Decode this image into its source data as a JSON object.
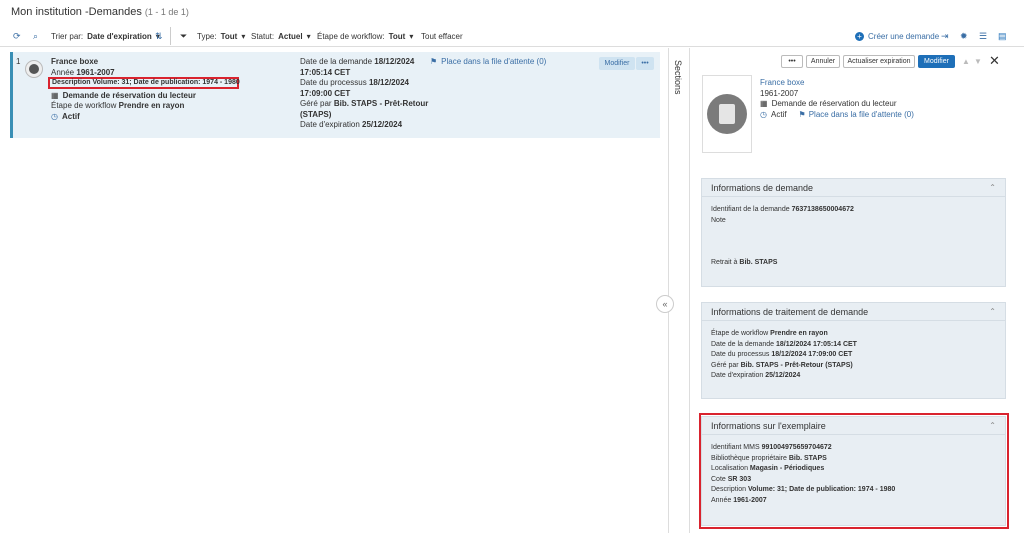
{
  "header": {
    "title": "Mon institution -Demandes",
    "count": "(1 - 1 de 1)"
  },
  "toolbar": {
    "sort_label": "Trier par:",
    "sort_value": "Date d'expiration",
    "type_label": "Type:",
    "type_value": "Tout",
    "status_label": "Statut:",
    "status_value": "Actuel",
    "workflow_label": "Étape de workflow:",
    "workflow_value": "Tout",
    "clear_all": "Tout effacer",
    "create_request": "Créer une demande"
  },
  "result": {
    "index": "1",
    "title": "France boxe",
    "year_label": "Année",
    "year": "1961-2007",
    "description": "Description Volume: 31; Date de publication: 1974 - 1980",
    "request_type": "Demande de réservation du lecteur",
    "workflow_label": "Étape de workflow",
    "workflow_value": "Prendre en rayon",
    "status": "Actif",
    "request_date_label": "Date de la demande",
    "request_date": "18/12/2024",
    "request_time": "17:05:14 CET",
    "process_date_label": "Date du processus",
    "process_date": "18/12/2024",
    "process_time": "17:09:00 CET",
    "managed_label": "Géré par",
    "managed_by": "Bib. STAPS - Prêt-Retour",
    "managed_by_2": "(STAPS)",
    "expiry_label": "Date d'expiration",
    "expiry_date": "25/12/2024",
    "queue_link": "Place dans la file d'attente (0)",
    "edit_button": "Modifier",
    "more_button": "•••"
  },
  "sections_label": "Sections",
  "detail": {
    "more_button": "•••",
    "cancel_button": "Annuler",
    "update_expiry_button": "Actualiser expiration",
    "edit_button": "Modifier",
    "title": "France boxe",
    "year": "1961-2007",
    "request_type": "Demande de réservation du lecteur",
    "status": "Actif",
    "queue_link": "Place dans la file d'attente (0)"
  },
  "panels": {
    "demand": {
      "title": "Informations de demande",
      "id_label": "Identifiant de la demande",
      "id": "7637138650004672",
      "note_label": "Note",
      "pickup_label": "Retrait à",
      "pickup": "Bib. STAPS"
    },
    "processing": {
      "title": "Informations de traitement de demande",
      "workflow_label": "Étape de workflow",
      "workflow": "Prendre en rayon",
      "request_date_label": "Date de la demande",
      "request_date": "18/12/2024 17:05:14 CET",
      "process_date_label": "Date du processus",
      "process_date": "18/12/2024 17:09:00 CET",
      "managed_label": "Géré par",
      "managed_by": "Bib. STAPS - Prêt-Retour (STAPS)",
      "expiry_label": "Date d'expiration",
      "expiry": "25/12/2024"
    },
    "item": {
      "title": "Informations sur l'exemplaire",
      "mms_label": "Identifiant MMS",
      "mms": "991004975659704672",
      "owner_label": "Bibliothèque propriétaire",
      "owner": "Bib. STAPS",
      "location_label": "Localisation",
      "location": "Magasin - Périodiques",
      "callno_label": "Cote",
      "callno": "SR 303",
      "description_label": "Description",
      "description": "Volume: 31; Date de publication: 1974 - 1980",
      "year_label": "Année",
      "year": "1961-2007"
    }
  },
  "colors": {
    "accent": "#1e6fb8",
    "highlight": "#d9232e",
    "selected_row": "#e8f1f7",
    "panel_bg": "#e8eef3"
  }
}
